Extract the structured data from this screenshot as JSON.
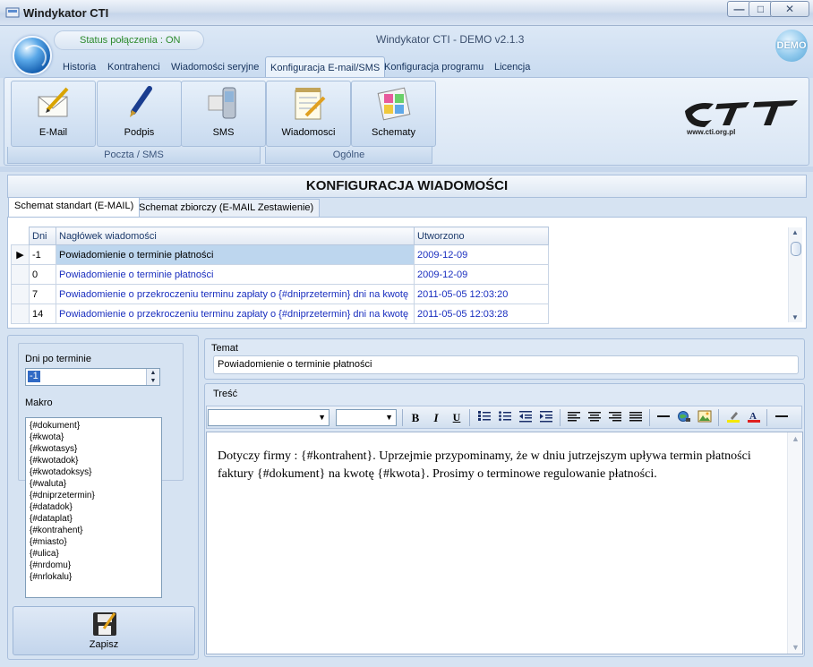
{
  "window": {
    "title": "Windykator CTI",
    "minimize": "—",
    "maximize": "□",
    "close": "✕"
  },
  "header": {
    "status": "Status połączenia : ON",
    "app_title": "Windykator CTI  - DEMO v2.1.3",
    "demo_badge": "DEMO"
  },
  "tabs": [
    "Historia",
    "Kontrahenci",
    "Wiadomości seryjne",
    "Konfiguracja E-mail/SMS",
    "Konfiguracja programu",
    "Licencja"
  ],
  "ribbon": {
    "buttons": [
      "E-Mail",
      "Podpis",
      "SMS",
      "Wiadomosci",
      "Schematy"
    ],
    "groups": [
      "Poczta / SMS",
      "Ogólne"
    ],
    "logo_text": "www.cti.org.pl"
  },
  "main": {
    "heading": "KONFIGURACJA WIADOMOŚCI",
    "subtabs": [
      "Schemat standart (E-MAIL)",
      "Schemat zbiorczy (E-MAIL Zestawienie)"
    ],
    "grid": {
      "columns": [
        "Dni",
        "Nagłówek wiadomości",
        "Utworzono"
      ],
      "rows": [
        {
          "dni": "-1",
          "naglowek": "Powiadomienie o terminie płatności",
          "utworzono": "2009-12-09"
        },
        {
          "dni": "0",
          "naglowek": "Powiadomienie o terminie płatności",
          "utworzono": "2009-12-09"
        },
        {
          "dni": "7",
          "naglowek": "Powiadomienie o przekroczeniu terminu zapłaty o {#dniprzetermin} dni na kwotę",
          "utworzono": "2011-05-05 12:03:20"
        },
        {
          "dni": "14",
          "naglowek": "Powiadomienie o przekroczeniu terminu zapłaty o {#dniprzetermin} dni na kwotę",
          "utworzono": "2011-05-05 12:03:28"
        }
      ]
    }
  },
  "left": {
    "dni_label": "Dni po terminie",
    "dni_value": "-1",
    "makro_label": "Makro",
    "makro": [
      "{#dokument}",
      "{#kwota}",
      "{#kwotasys}",
      "{#kwotadok}",
      "{#kwotadoksys}",
      "{#waluta}",
      "{#dniprzetermin}",
      "{#datadok}",
      "{#dataplat}",
      "{#kontrahent}",
      "{#miasto}",
      "{#ulica}",
      "{#nrdomu}",
      "{#nrlokalu}"
    ],
    "save_label": "Zapisz"
  },
  "right": {
    "temat_label": "Temat",
    "temat_value": "Powiadomienie o terminie płatności",
    "tresc_label": "Treść",
    "body_text": "Dotyczy firmy : {#kontrahent}. Uprzejmie przypominamy, że w dniu jutrzejszym upływa termin płatności faktury {#dokument} na kwotę {#kwota}. Prosimy o terminowe regulowanie płatności."
  },
  "toolbar": {
    "bold": "B",
    "italic": "I",
    "underline": "U"
  }
}
